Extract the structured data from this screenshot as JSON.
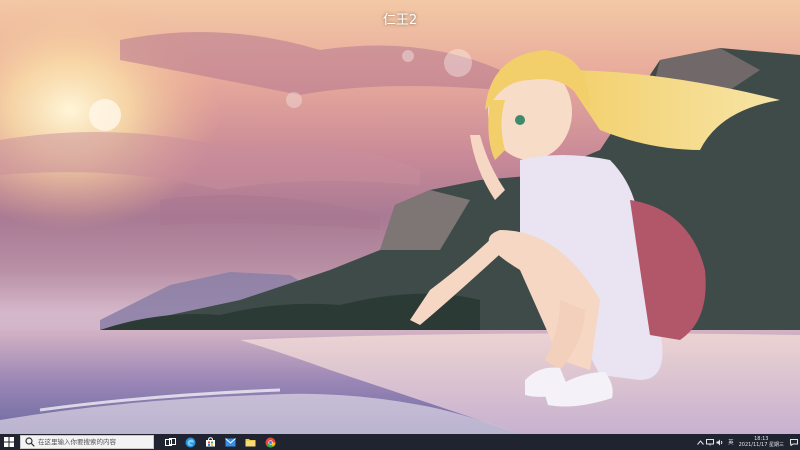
{
  "window": {
    "title": "仁王2"
  },
  "taskbar": {
    "search_placeholder": "在这里输入你要搜索的内容",
    "pinned": [
      {
        "name": "task-view-icon",
        "color": "#ffffff"
      },
      {
        "name": "edge-icon",
        "color": "#2b8fd9"
      },
      {
        "name": "store-icon",
        "color": "#ffffff"
      },
      {
        "name": "mail-icon",
        "color": "#3a8ee6"
      },
      {
        "name": "file-explorer-icon",
        "color": "#f2c94c"
      },
      {
        "name": "chrome-icon",
        "color": "#e8453c"
      }
    ],
    "tray": {
      "ime_label": "英",
      "time": "18:13",
      "date": "2021/11/17 星期三"
    }
  }
}
